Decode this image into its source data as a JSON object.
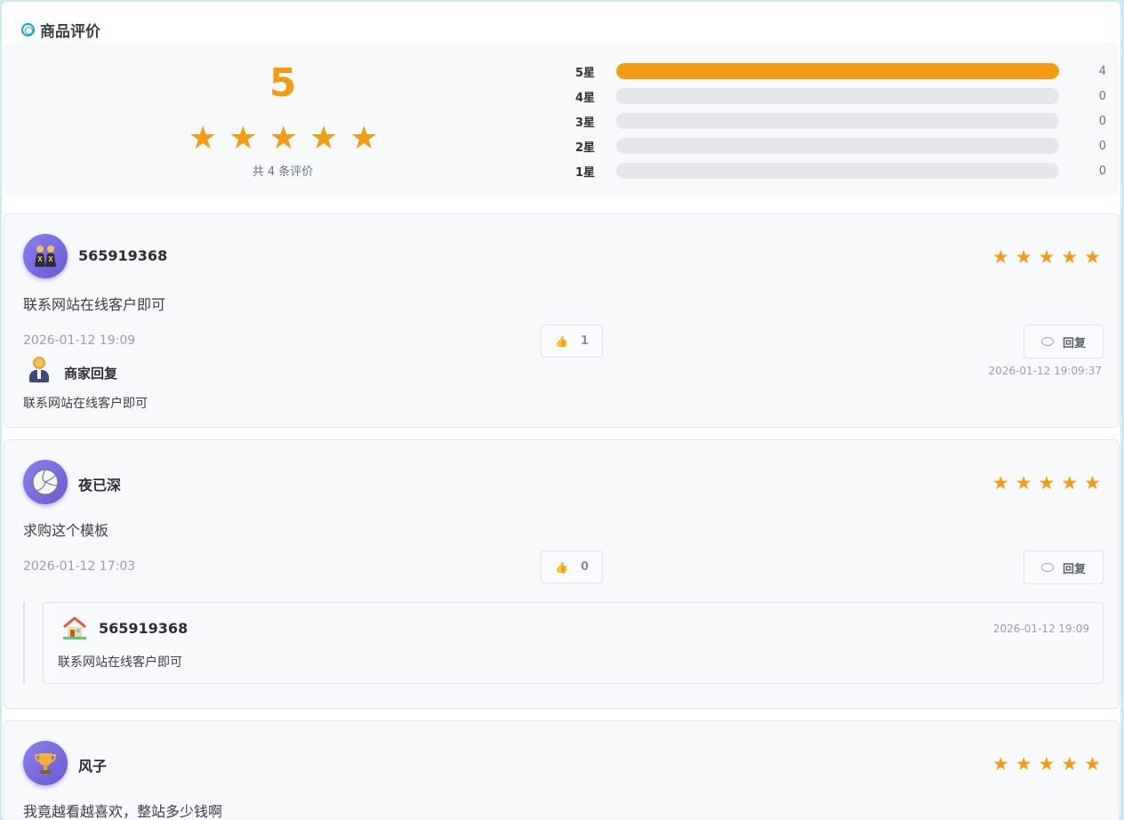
{
  "header": {
    "title": "商品评价"
  },
  "summary": {
    "average": "5",
    "average_stars": 5,
    "total_label": "共 4 条评价",
    "distribution": [
      {
        "label": "5星",
        "count": "4",
        "fraction": 1.0
      },
      {
        "label": "4星",
        "count": "0",
        "fraction": 0
      },
      {
        "label": "3星",
        "count": "0",
        "fraction": 0
      },
      {
        "label": "2星",
        "count": "0",
        "fraction": 0
      },
      {
        "label": "1星",
        "count": "0",
        "fraction": 0
      }
    ]
  },
  "colors": {
    "accent": "#f39c12",
    "track": "#e5e7eb",
    "avatar": "#7b6fe0"
  },
  "reviews": [
    {
      "user": "565919368",
      "avatar_icon": "people-icon",
      "stars": 5,
      "content": "联系网站在线客户即可",
      "date": "2026-01-12 19:09",
      "likes": "1",
      "reply_label": "回复",
      "merchant_reply": {
        "label": "商家回复",
        "date": "2026-01-12 19:09:37",
        "text": "联系网站在线客户即可"
      }
    },
    {
      "user": "夜已深",
      "avatar_icon": "volleyball-icon",
      "stars": 5,
      "content": "求购这个模板",
      "date": "2026-01-12 17:03",
      "likes": "0",
      "reply_label": "回复",
      "user_reply": {
        "user": "565919368",
        "date": "2026-01-12 19:09",
        "text": "联系网站在线客户即可"
      }
    },
    {
      "user": "风子",
      "avatar_icon": "trophy-icon",
      "stars": 5,
      "content": "我竟越看越喜欢，整站多少钱啊"
    }
  ]
}
